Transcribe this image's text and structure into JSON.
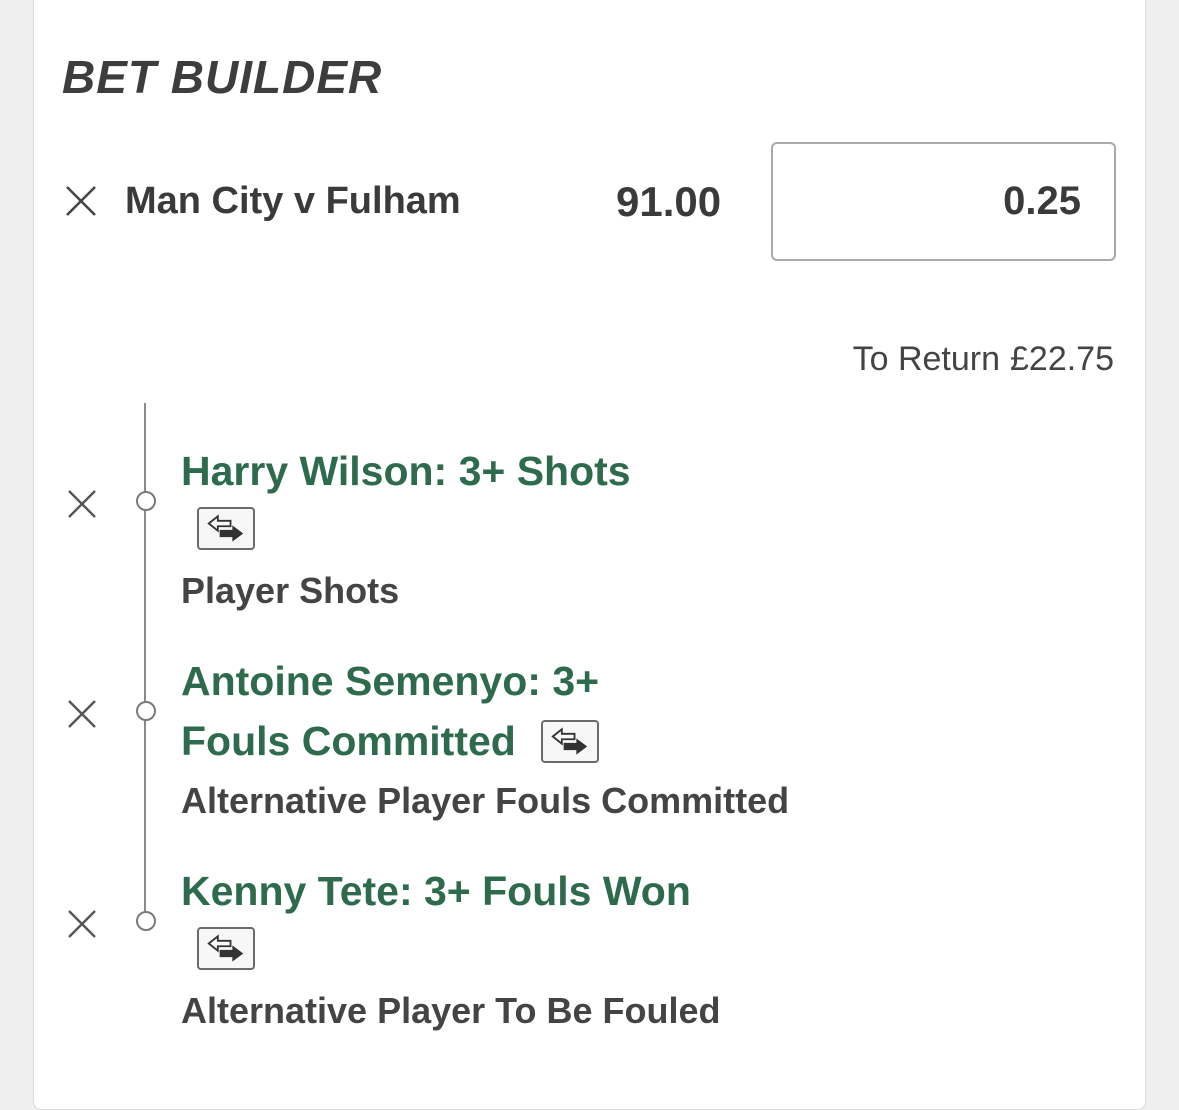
{
  "header": {
    "title": "BET BUILDER"
  },
  "bet": {
    "match": "Man City v Fulham",
    "odds": "91.00",
    "stake": "0.25",
    "to_return_label": "To Return",
    "to_return_value": "£22.75"
  },
  "selections": [
    {
      "name_line1": "Harry Wilson: 3+ Shots",
      "market": "Player Shots"
    },
    {
      "name_line1": "Antoine Semenyo: 3+",
      "name_line2": "Fouls Committed",
      "market": "Alternative Player Fouls Committed"
    },
    {
      "name_line1": "Kenny Tete: 3+ Fouls Won",
      "market": "Alternative Player To Be Fouled"
    }
  ],
  "icons": {
    "remove": "close-icon",
    "swap": "swap-arrows-icon",
    "node": "timeline-node"
  },
  "colors": {
    "selection_green": "#2e6b4c",
    "text_dark": "#3a3a3a",
    "card_bg": "#ffffff",
    "page_bg": "#efefef"
  }
}
